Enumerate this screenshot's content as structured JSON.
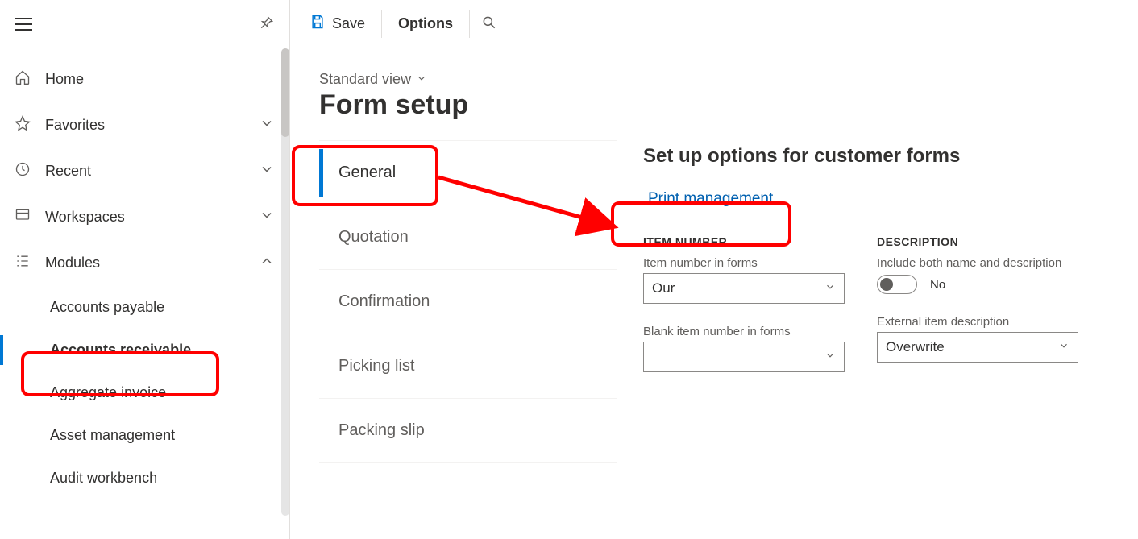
{
  "sidebar": {
    "nav": {
      "home": "Home",
      "favorites": "Favorites",
      "recent": "Recent",
      "workspaces": "Workspaces",
      "modules": "Modules"
    },
    "modules_items": [
      "Accounts payable",
      "Accounts receivable",
      "Aggregate invoice",
      "Asset management",
      "Audit workbench"
    ],
    "active_sub_index": 1
  },
  "action_bar": {
    "save": "Save",
    "options": "Options"
  },
  "page": {
    "view_name": "Standard view",
    "title": "Form setup",
    "vtabs": [
      "General",
      "Quotation",
      "Confirmation",
      "Picking list",
      "Packing slip"
    ],
    "active_vtab_index": 0
  },
  "panel": {
    "heading": "Set up options for customer forms",
    "print_mgmt": "Print management",
    "section_item_number": "ITEM NUMBER",
    "section_description": "DESCRIPTION",
    "labels": {
      "item_number_in_forms": "Item number in forms",
      "blank_item_number_in_forms": "Blank item number in forms",
      "include_both": "Include both name and description",
      "external_item_desc": "External item description"
    },
    "values": {
      "item_number_in_forms": "Our",
      "blank_item_number_in_forms": "",
      "include_both_toggle": "No",
      "external_item_desc": "Overwrite"
    }
  }
}
